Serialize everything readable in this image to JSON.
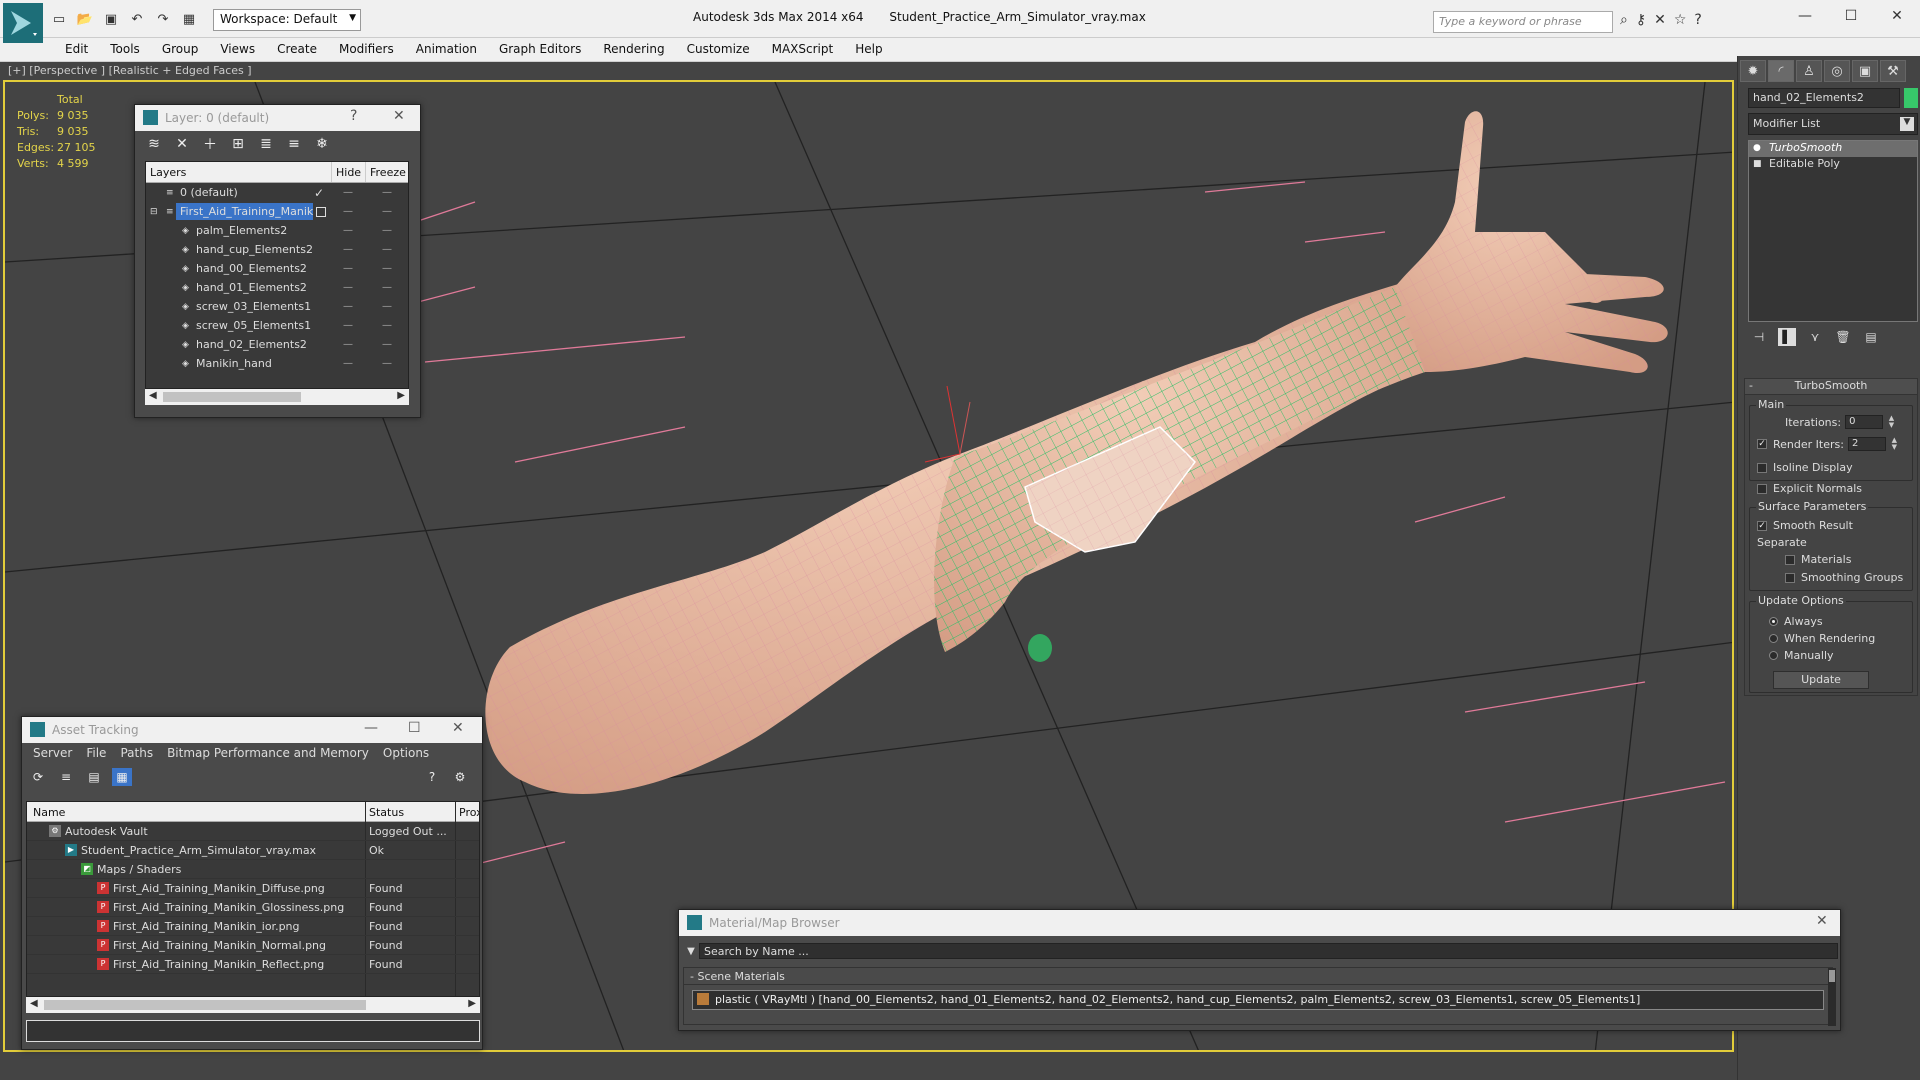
{
  "app": {
    "title": "Autodesk 3ds Max  2014 x64",
    "file": "Student_Practice_Arm_Simulator_vray.max",
    "workspace": "Workspace: Default",
    "search_placeholder": "Type a keyword or phrase"
  },
  "menu": [
    "Edit",
    "Tools",
    "Group",
    "Views",
    "Create",
    "Modifiers",
    "Animation",
    "Graph Editors",
    "Rendering",
    "Customize",
    "MAXScript",
    "Help"
  ],
  "viewport": {
    "label": "[+] [Perspective ] [Realistic + Edged Faces ]",
    "stats": {
      "total_label": "Total",
      "rows": [
        {
          "k": "Polys:",
          "v": "9 035"
        },
        {
          "k": "Tris:",
          "v": "9 035"
        },
        {
          "k": "Edges:",
          "v": "27 105"
        },
        {
          "k": "Verts:",
          "v": "4 599"
        }
      ]
    }
  },
  "layer_dialog": {
    "title": "Layer: 0 (default)",
    "help": "?",
    "columns": [
      "Layers",
      "Hide",
      "Freeze"
    ],
    "rows": [
      {
        "name": "0 (default)",
        "level": 0
      },
      {
        "name": "First_Aid_Training_Manikin",
        "level": 0,
        "selected": true
      },
      {
        "name": "palm_Elements2",
        "level": 1
      },
      {
        "name": "hand_cup_Elements2",
        "level": 1
      },
      {
        "name": "hand_00_Elements2",
        "level": 1
      },
      {
        "name": "hand_01_Elements2",
        "level": 1
      },
      {
        "name": "screw_03_Elements1",
        "level": 1
      },
      {
        "name": "screw_05_Elements1",
        "level": 1
      },
      {
        "name": "hand_02_Elements2",
        "level": 1
      },
      {
        "name": "Manikin_hand",
        "level": 1
      }
    ]
  },
  "asset_dialog": {
    "title": "Asset Tracking",
    "menu": [
      "Server",
      "File",
      "Paths",
      "Bitmap Performance and Memory",
      "Options"
    ],
    "columns": [
      "Name",
      "Status",
      "Prox"
    ],
    "rows": [
      {
        "name": "Autodesk Vault",
        "status": "Logged Out ...",
        "indent": 0,
        "icon": "vault-icon"
      },
      {
        "name": "Student_Practice_Arm_Simulator_vray.max",
        "status": "Ok",
        "indent": 1,
        "icon": "max-file-icon"
      },
      {
        "name": "Maps / Shaders",
        "status": "",
        "indent": 2,
        "icon": "maps-folder-icon"
      },
      {
        "name": "First_Aid_Training_Manikin_Diffuse.png",
        "status": "Found",
        "indent": 3,
        "icon": "png-icon"
      },
      {
        "name": "First_Aid_Training_Manikin_Glossiness.png",
        "status": "Found",
        "indent": 3,
        "icon": "png-icon"
      },
      {
        "name": "First_Aid_Training_Manikin_ior.png",
        "status": "Found",
        "indent": 3,
        "icon": "png-icon"
      },
      {
        "name": "First_Aid_Training_Manikin_Normal.png",
        "status": "Found",
        "indent": 3,
        "icon": "png-icon"
      },
      {
        "name": "First_Aid_Training_Manikin_Reflect.png",
        "status": "Found",
        "indent": 3,
        "icon": "png-icon"
      }
    ]
  },
  "material_dialog": {
    "title": "Material/Map Browser",
    "search_placeholder": "Search by Name ...",
    "section": "- Scene Materials",
    "item": "plastic  ( VRayMtl )  [hand_00_Elements2, hand_01_Elements2, hand_02_Elements2, hand_cup_Elements2, palm_Elements2, screw_03_Elements1, screw_05_Elements1]"
  },
  "command_panel": {
    "object_name": "hand_02_Elements2",
    "object_color": "#37c86a",
    "modifier_list": "Modifier List",
    "stack": [
      "TurboSmooth",
      "Editable Poly"
    ],
    "rollout_title": "TurboSmooth",
    "main_label": "Main",
    "iterations_label": "Iterations:",
    "iterations_value": "0",
    "render_iters_label": "Render Iters:",
    "render_iters_value": "2",
    "isoline": "Isoline Display",
    "explicit_normals": "Explicit Normals",
    "surface_params": "Surface Parameters",
    "smooth_result": "Smooth Result",
    "separate": "Separate",
    "materials": "Materials",
    "smoothing_groups": "Smoothing Groups",
    "update_options": "Update Options",
    "always": "Always",
    "when_rendering": "When Rendering",
    "manually": "Manually",
    "update_btn": "Update"
  },
  "colors": {
    "viewport_border": "#e2cd3a",
    "selection": "#3a74c8",
    "skin": "#e9b9a1",
    "wire_selected": "#2fbf67"
  }
}
